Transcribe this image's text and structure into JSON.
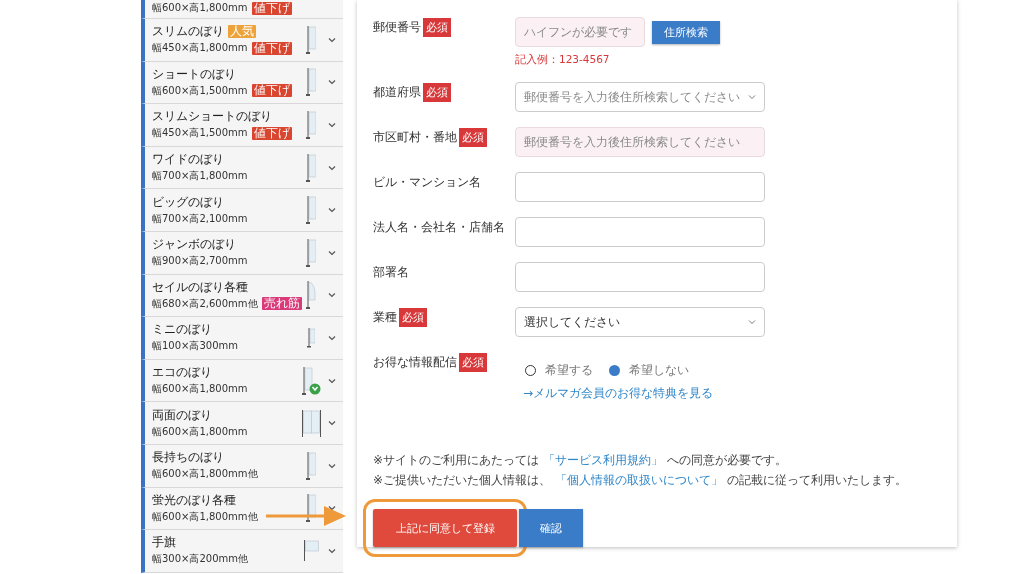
{
  "sidebar": {
    "items": [
      {
        "spec": "幅600×高1,800mm",
        "spec_badge": {
          "text": "値下げ",
          "color": "#d9452f"
        }
      },
      {
        "title": "スリムのぼり",
        "spec": "幅450×高1,800mm",
        "title_badge": {
          "text": "人気",
          "color": "#eea23a"
        },
        "spec_badge": {
          "text": "値下げ",
          "color": "#d9452f"
        },
        "kind": "banner"
      },
      {
        "title": "ショートのぼり",
        "spec": "幅600×高1,500mm",
        "spec_badge": {
          "text": "値下げ",
          "color": "#d9452f"
        },
        "kind": "banner"
      },
      {
        "title": "スリムショートのぼり",
        "spec": "幅450×高1,500mm",
        "spec_badge": {
          "text": "値下げ",
          "color": "#d9452f"
        },
        "kind": "banner"
      },
      {
        "title": "ワイドのぼり",
        "spec": "幅700×高1,800mm",
        "kind": "banner"
      },
      {
        "title": "ビッグのぼり",
        "spec": "幅700×高2,100mm",
        "kind": "banner"
      },
      {
        "title": "ジャンボのぼり",
        "spec": "幅900×高2,700mm",
        "kind": "banner"
      },
      {
        "title": "セイルのぼり各種",
        "spec": "幅680×高2,600mm他",
        "spec_badge": {
          "text": "売れ筋",
          "color": "#d93a7a"
        },
        "kind": "sail"
      },
      {
        "title": "ミニのぼり",
        "spec": "幅100×高300mm",
        "kind": "mini"
      },
      {
        "title": "エコのぼり",
        "spec": "幅600×高1,800mm",
        "kind": "eco"
      },
      {
        "title": "両面のぼり",
        "spec": "幅600×高1,800mm",
        "kind": "double"
      },
      {
        "title": "長持ちのぼり",
        "spec": "幅600×高1,800mm他",
        "kind": "banner"
      },
      {
        "title": "蛍光のぼり各種",
        "spec": "幅600×高1,800mm他",
        "kind": "banner"
      },
      {
        "title": "手旗",
        "spec": "幅300×高200mm他",
        "kind": "handheld"
      }
    ]
  },
  "form": {
    "rows": [
      {
        "label": "郵便番号",
        "badge": "必須",
        "kind": "input",
        "placeholder": "ハイフンが必要です",
        "tinted": true,
        "button": "住所検索",
        "hint": "記入例：123-4567"
      },
      {
        "label": "都道府県",
        "badge": "必須",
        "kind": "select",
        "placeholder": "郵便番号を入力後住所検索してください",
        "tinted": false
      },
      {
        "label": "市区町村・番地",
        "badge": "必須",
        "kind": "input",
        "placeholder": "郵便番号を入力後住所検索してください",
        "tinted": true
      },
      {
        "label": "ビル・マンション名",
        "kind": "input",
        "tinted": false
      },
      {
        "label": "法人名・会社名・店舗名",
        "kind": "input",
        "tinted": false
      },
      {
        "label": "部署名",
        "kind": "input",
        "tinted": false
      },
      {
        "label": "業種",
        "badge": "必須",
        "kind": "select",
        "value": "選択してください",
        "tinted": false
      },
      {
        "label": "お得な情報配信",
        "badge": "必須",
        "kind": "radio",
        "options": [
          {
            "label": "希望する",
            "selected": false
          },
          {
            "label": "希望しない",
            "selected": true
          }
        ],
        "link": "→メルマガ会員のお得な特典を見る"
      }
    ],
    "notes": [
      {
        "before": "※サイトのご利用にあたっては ",
        "link": "「サービス利用規約」",
        "after": " への同意が必要です。"
      },
      {
        "before": "※ご提供いただいた個人情報は、 ",
        "link": "「個人情報の取扱いについて」",
        "after": " の記載に従って利用いたします。"
      }
    ],
    "buttons": [
      {
        "label": "上記に同意して登録",
        "kind": "primary",
        "highlighted": true
      },
      {
        "label": "確認",
        "kind": "secondary",
        "highlighted": false
      }
    ]
  }
}
